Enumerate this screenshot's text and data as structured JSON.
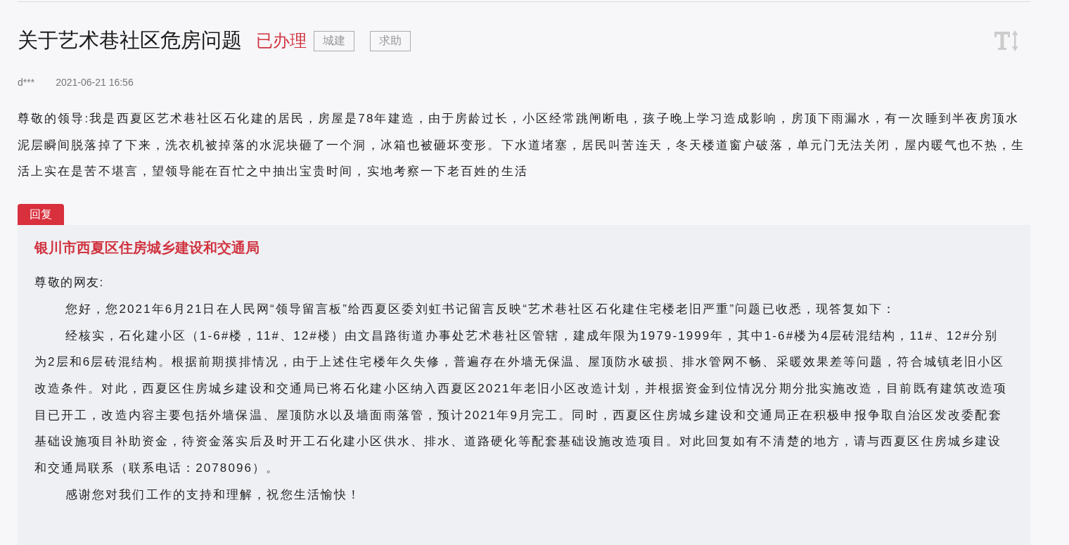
{
  "title": "关于艺术巷社区危房问题",
  "status": "已办理",
  "tags": [
    "城建",
    "求助"
  ],
  "meta": {
    "author": "d***",
    "time": "2021-06-21 16:56"
  },
  "content": "尊敬的领导:我是西夏区艺术巷社区石化建的居民，房屋是78年建造，由于房龄过长，小区经常跳闸断电，孩子晚上学习造成影响，房顶下雨漏水，有一次睡到半夜房顶水泥层瞬间脱落掉了下来，洗衣机被掉落的水泥块砸了一个洞，冰箱也被砸坏变形。下水道堵塞，居民叫苦连天，冬天楼道窗户破落，单元门无法关闭，屋内暖气也不热，生活上实在是苦不堪言，望领导能在百忙之中抽出宝贵时间，实地考察一下老百姓的生活",
  "reply": {
    "tab": "回复",
    "department": "银川市西夏区住房城乡建设和交通局",
    "greeting": "尊敬的网友:",
    "paragraphs": [
      "您好，您2021年6月21日在人民网“领导留言板”给西夏区委刘虹书记留言反映“艺术巷社区石化建住宅楼老旧严重”问题已收悉，现答复如下：",
      "经核实，石化建小区（1-6#楼，11#、12#楼）由文昌路街道办事处艺术巷社区管辖，建成年限为1979-1999年，其中1-6#楼为4层砖混结构，11#、12#分别为2层和6层砖混结构。根据前期摸排情况，由于上述住宅楼年久失修，普遍存在外墙无保温、屋顶防水破损、排水管网不畅、采暖效果差等问题，符合城镇老旧小区改造条件。对此，西夏区住房城乡建设和交通局已将石化建小区纳入西夏区2021年老旧小区改造计划，并根据资金到位情况分期分批实施改造，目前既有建筑改造项目已开工，改造内容主要包括外墙保温、屋顶防水以及墙面雨落管，预计2021年9月完工。同时，西夏区住房城乡建设和交通局正在积极申报争取自治区发改委配套基础设施项目补助资金，待资金落实后及时开工石化建小区供水、排水、道路硬化等配套基础设施改造项目。对此回复如有不清楚的地方，请与西夏区住房城乡建设和交通局联系（联系电话：2078096）。",
      "感谢您对我们工作的支持和理解，祝您生活愉快！"
    ]
  }
}
